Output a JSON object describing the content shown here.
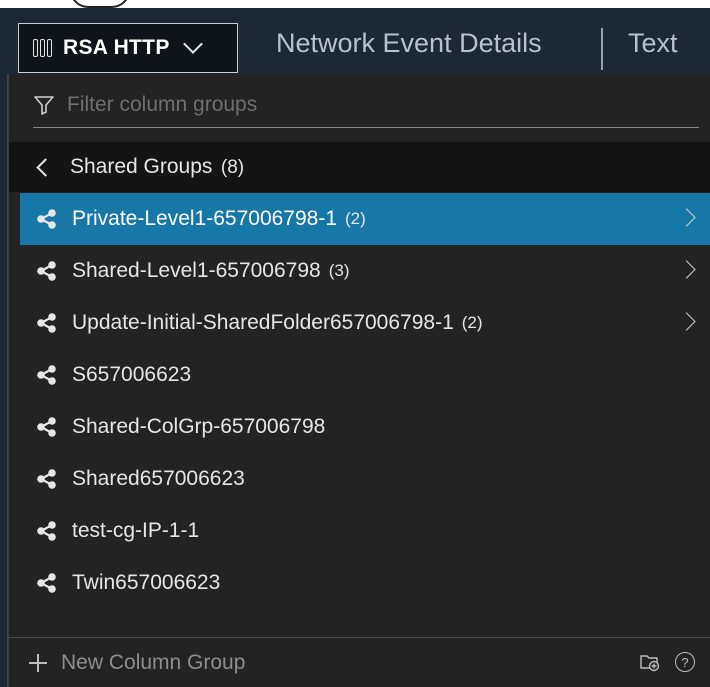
{
  "header": {
    "group_selector_label": "RSA HTTP",
    "tabs": [
      {
        "label": "Network Event Details"
      },
      {
        "label": "Text"
      }
    ]
  },
  "filter": {
    "placeholder": "Filter column groups",
    "value": ""
  },
  "shared_groups": {
    "title": "Shared Groups",
    "count": "(8)",
    "items": [
      {
        "name": "Private-Level1-657006798-1",
        "count": "(2)",
        "has_children": true,
        "selected": true
      },
      {
        "name": "Shared-Level1-657006798",
        "count": "(3)",
        "has_children": true,
        "selected": false
      },
      {
        "name": "Update-Initial-SharedFolder657006798-1",
        "count": "(2)",
        "has_children": true,
        "selected": false
      },
      {
        "name": "S657006623",
        "count": "",
        "has_children": false,
        "selected": false
      },
      {
        "name": "Shared-ColGrp-657006798",
        "count": "",
        "has_children": false,
        "selected": false
      },
      {
        "name": "Shared657006623",
        "count": "",
        "has_children": false,
        "selected": false
      },
      {
        "name": "test-cg-IP-1-1",
        "count": "",
        "has_children": false,
        "selected": false
      },
      {
        "name": "Twin657006623",
        "count": "",
        "has_children": false,
        "selected": false
      }
    ]
  },
  "footer": {
    "new_group_label": "New Column Group",
    "help_glyph": "?"
  },
  "icons": {
    "row_icon": "share-icon",
    "footer_icons": [
      "new-folder-icon",
      "help-icon"
    ]
  },
  "colors": {
    "selected_row": "#1777a6",
    "panel_bg": "#232323",
    "topbar_bg": "#1d2835"
  }
}
